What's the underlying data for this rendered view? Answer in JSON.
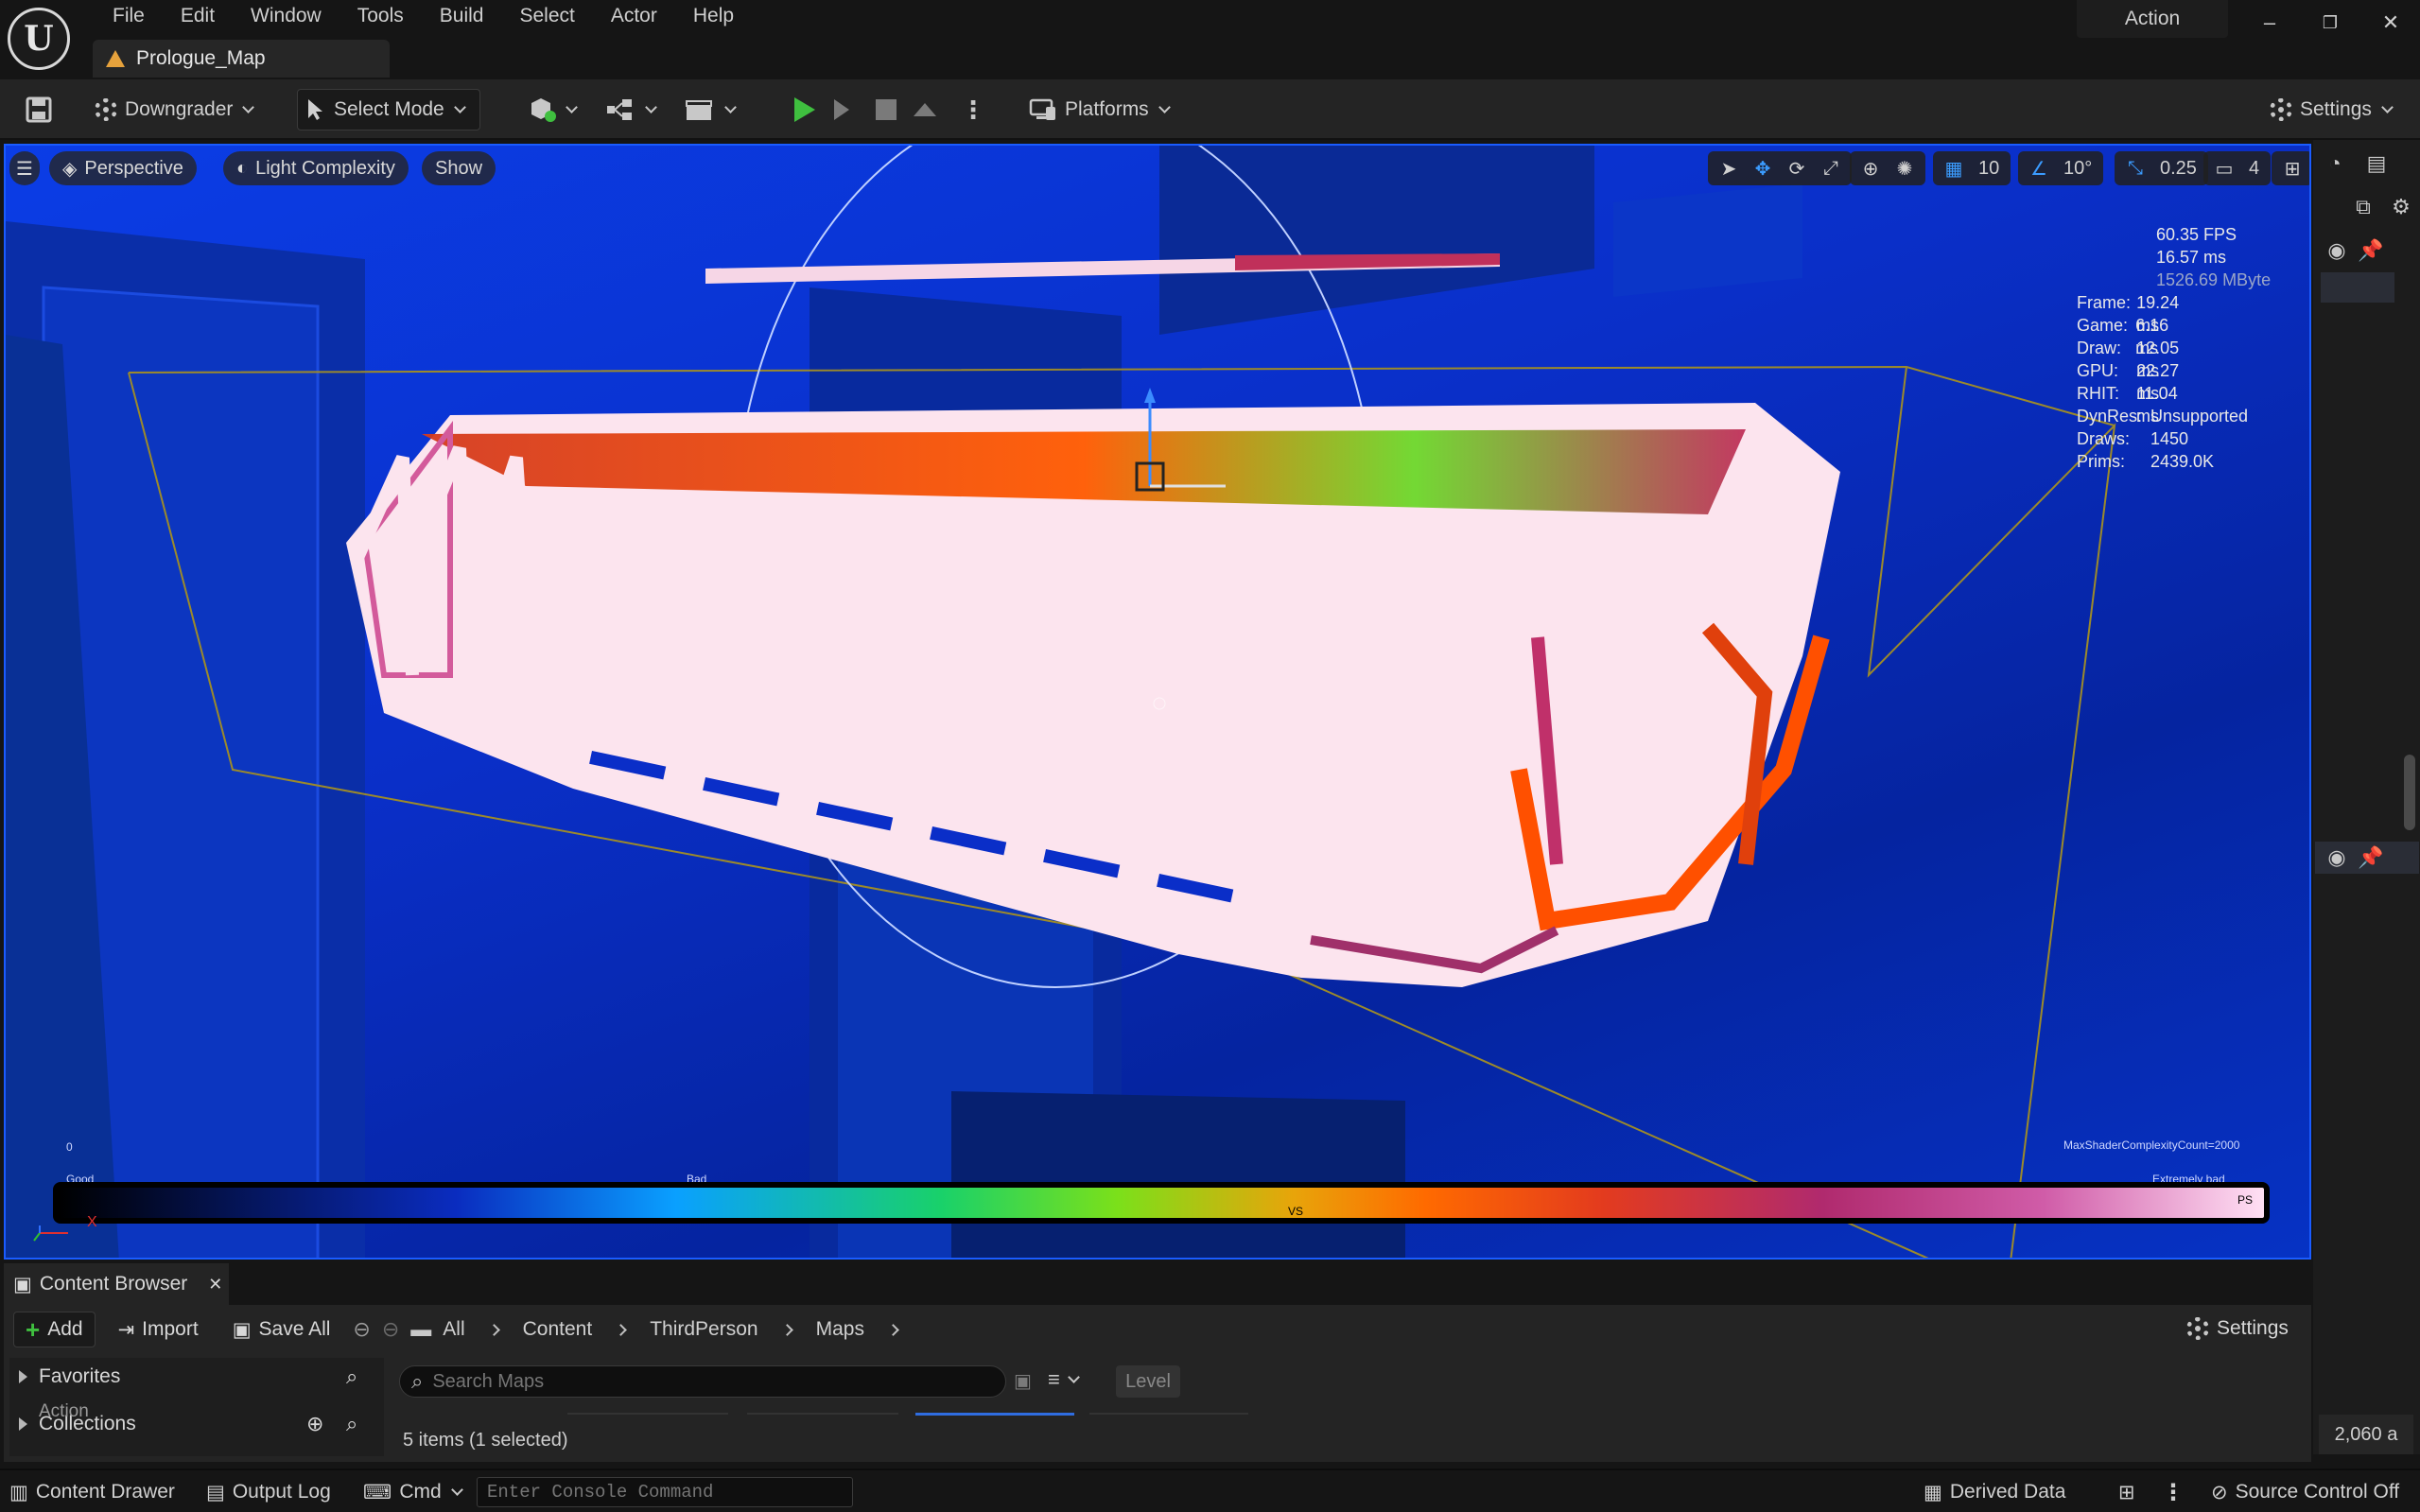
{
  "app": {
    "menu": [
      "File",
      "Edit",
      "Window",
      "Tools",
      "Build",
      "Select",
      "Actor",
      "Help"
    ],
    "map_tab": "Prologue_Map",
    "layout_badge": "Action",
    "window_controls": {
      "minimize": "–",
      "restore": "❐",
      "close": "✕"
    }
  },
  "toolbar": {
    "downgrader": "Downgrader",
    "select_mode": "Select Mode",
    "platforms": "Platforms",
    "settings": "Settings"
  },
  "viewport": {
    "perspective": "Perspective",
    "view_mode": "Light Complexity",
    "show": "Show",
    "grid_snap": "10",
    "rotation_snap": "10°",
    "scale_snap": "0.25",
    "camera_speed": "4",
    "stats": {
      "fps": "60.35 FPS",
      "ms": "16.57 ms",
      "mem": "1526.69 MByte",
      "rows": [
        {
          "k": "Frame:",
          "v": "19.24 ms"
        },
        {
          "k": "Game:",
          "v": "6.16 ms"
        },
        {
          "k": "Draw:",
          "v": "12.05 ms"
        },
        {
          "k": "GPU:",
          "v": "22.27 ms"
        },
        {
          "k": "RHIT:",
          "v": "11.04 ms"
        },
        {
          "k": "DynRes:",
          "v": "Unsupported"
        },
        {
          "k": "Draws:",
          "v": "1450"
        },
        {
          "k": "Prims:",
          "v": "2439.0K"
        }
      ]
    },
    "complexity": {
      "zero": "0",
      "good": "Good",
      "bad": "Bad",
      "extremely_bad": "Extremely bad",
      "max_label": "MaxShaderComplexityCount=2000",
      "vs": "VS",
      "ps": "PS"
    },
    "axis": {
      "x": "X"
    }
  },
  "right_panel": {
    "count": "2,060 a"
  },
  "content_browser": {
    "tab_title": "Content Browser",
    "add": "Add",
    "import": "Import",
    "save_all": "Save All",
    "breadcrumbs": [
      "All",
      "Content",
      "ThirdPerson",
      "Maps"
    ],
    "settings": "Settings",
    "favorites": "Favorites",
    "action_overlap": "Action",
    "collections": "Collections",
    "search_placeholder": "Search Maps",
    "filter_chip": "Level",
    "items_count": "5 items (1 selected)"
  },
  "statusbar": {
    "content_drawer": "Content Drawer",
    "output_log": "Output Log",
    "cmd": "Cmd",
    "console_placeholder": "Enter Console Command",
    "derived_data": "Derived Data",
    "source_control": "Source Control Off"
  },
  "colors": {
    "accent_blue": "#3b9cff",
    "play_green": "#3fbf3f",
    "viewport_blue": "#0a2fc8"
  }
}
